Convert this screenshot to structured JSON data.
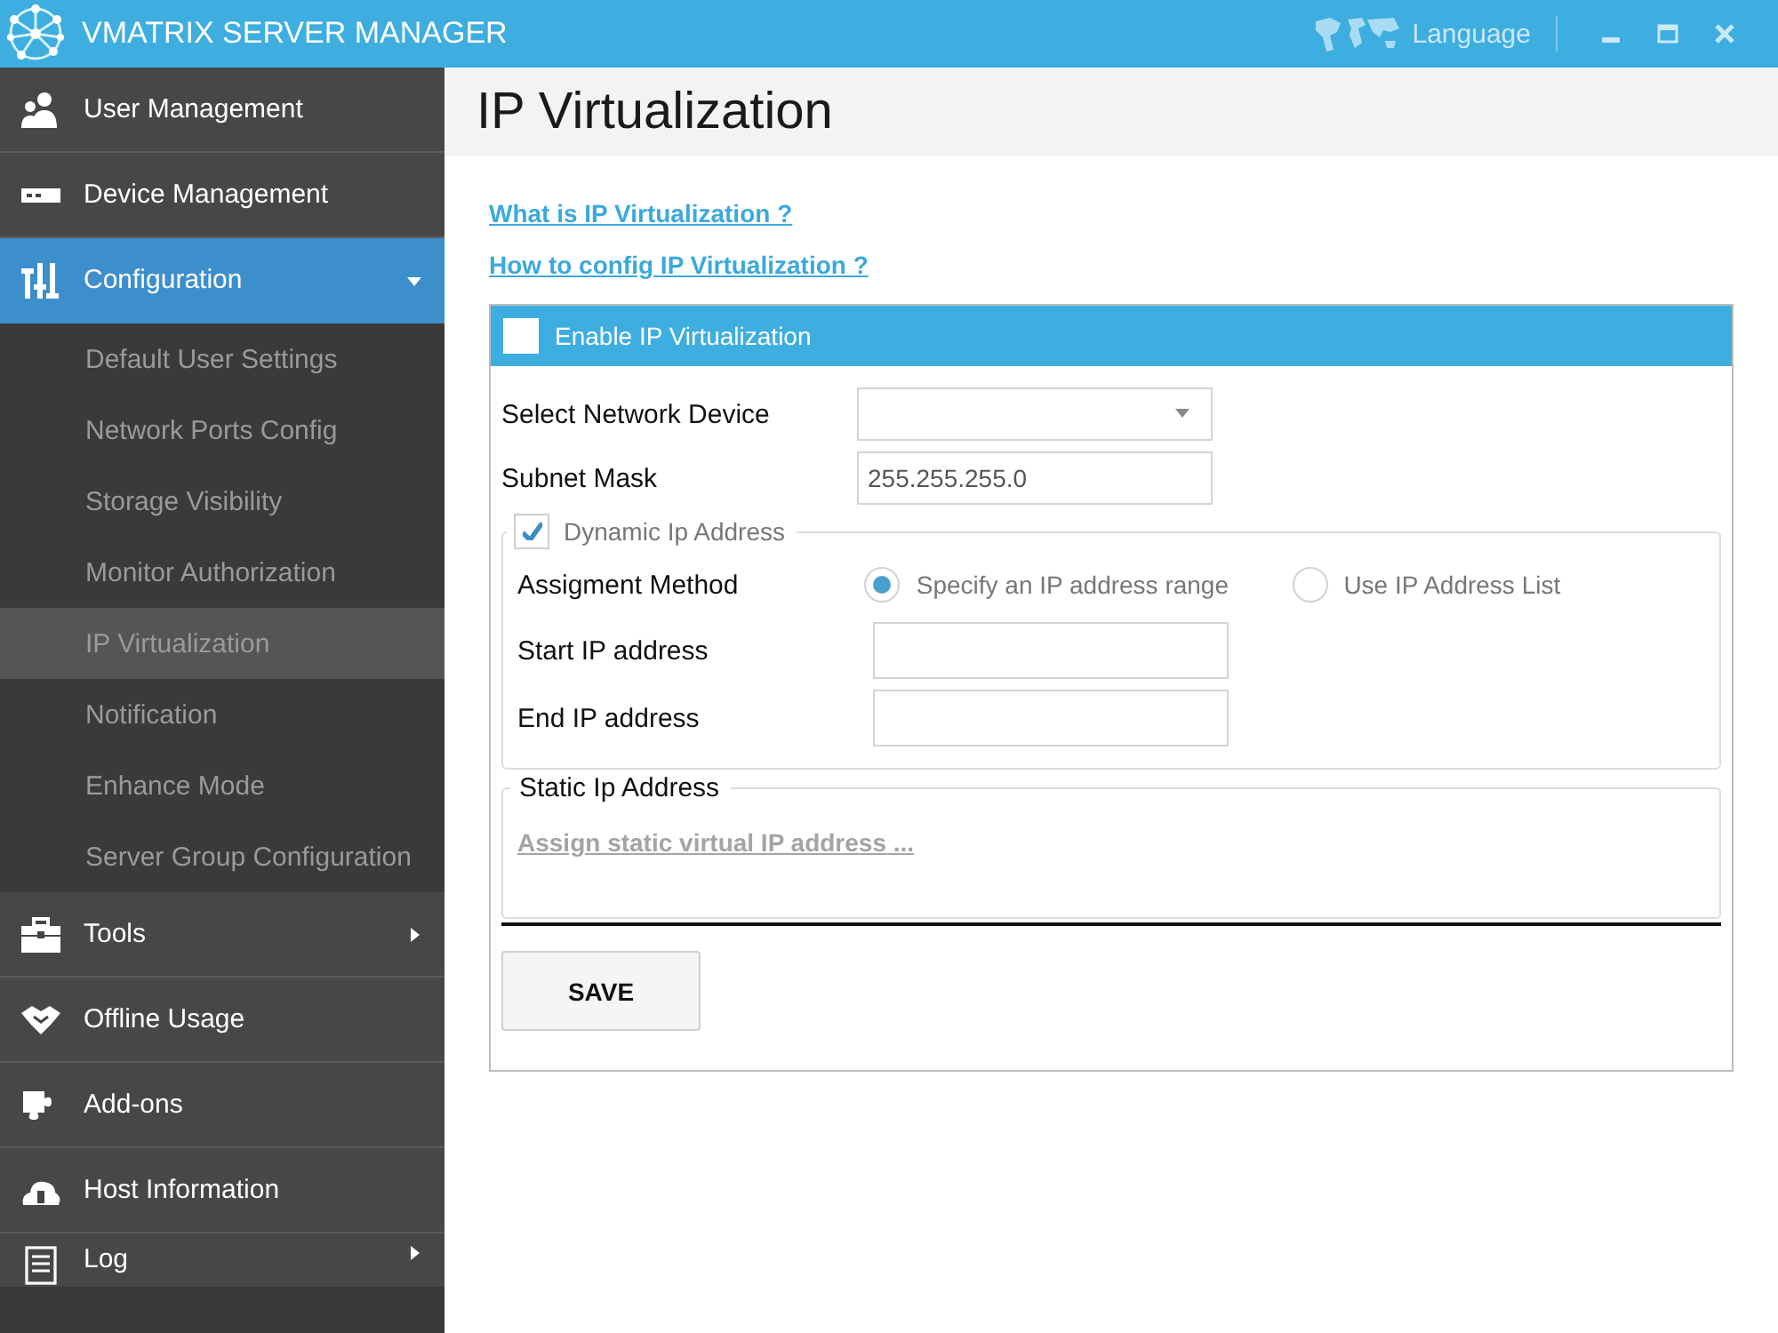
{
  "window": {
    "title": "VMATRIX SERVER MANAGER",
    "language": "Language"
  },
  "sidebar": {
    "items": [
      {
        "kind": "link",
        "label": "User Management",
        "selected": false
      },
      {
        "kind": "link",
        "label": "Device Management",
        "selected": false
      },
      {
        "kind": "folder",
        "label": "Configuration",
        "selected": true,
        "expanded": true
      },
      {
        "kind": "subitem",
        "label": "Default User Settings",
        "selected": false
      },
      {
        "kind": "subitem",
        "label": "Network Ports Config",
        "selected": false
      },
      {
        "kind": "subitem",
        "label": "Storage Visibility",
        "selected": false
      },
      {
        "kind": "subitem",
        "label": "Monitor Authorization",
        "selected": false
      },
      {
        "kind": "subitem",
        "label": "IP Virtualization",
        "selected": true
      },
      {
        "kind": "subitem",
        "label": "Notification",
        "selected": false
      },
      {
        "kind": "subitem",
        "label": "Enhance Mode",
        "selected": false
      },
      {
        "kind": "subitem",
        "label": "Server Group Configuration",
        "selected": false
      },
      {
        "kind": "folder",
        "label": "Tools",
        "selected": false,
        "expanded": false
      },
      {
        "kind": "link",
        "label": "Offline Usage",
        "selected": false
      },
      {
        "kind": "link",
        "label": "Add-ons",
        "selected": false
      },
      {
        "kind": "link",
        "label": "Host Information",
        "selected": false
      },
      {
        "kind": "folder",
        "label": "Log",
        "selected": false,
        "expanded": false
      }
    ]
  },
  "page": {
    "title": "IP Virtualization",
    "links": [
      "What is IP Virtualization ?",
      "How to config IP Virtualization ?"
    ],
    "panel": {
      "enable_label": "Enable IP Virtualization",
      "enable_checked": false,
      "network_device_label": "Select Network Device",
      "subnet_label": "Subnet Mask",
      "subnet_value": "255.255.255.0",
      "dynamic": {
        "label": "Dynamic Ip Address",
        "checked": true,
        "method_label": "Assigment Method",
        "options": [
          {
            "label": "Specify an IP address range",
            "selected": true
          },
          {
            "label": "Use IP Address List",
            "selected": false
          }
        ],
        "start_label": "Start IP address",
        "end_label": "End IP address"
      },
      "static": {
        "label": "Static Ip Address",
        "link": "Assign static virtual IP address ..."
      },
      "save": "SAVE"
    }
  }
}
